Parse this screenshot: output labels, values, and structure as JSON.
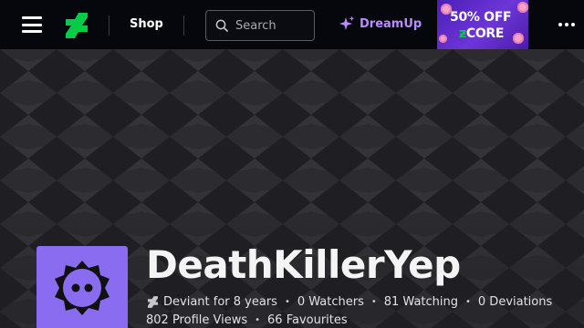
{
  "header": {
    "shop_label": "Shop",
    "search_placeholder": "Search",
    "dreamup_label": "DreamUp",
    "brand_color": "#05cc47",
    "dreamup_color": "#b98cff"
  },
  "ad": {
    "line1": "50% OFF",
    "line2_prefix": "ƶ",
    "line2_text": "CORE"
  },
  "profile": {
    "username": "DeathKillerYep",
    "deviant_for": "Deviant for 8 years",
    "watchers": "0 Watchers",
    "watching": "81 Watching",
    "deviations": "0 Deviations",
    "profile_views": "802 Profile Views",
    "favourites": "66 Favourites",
    "avatar_color": "#8a6cf0"
  },
  "separator": "•"
}
